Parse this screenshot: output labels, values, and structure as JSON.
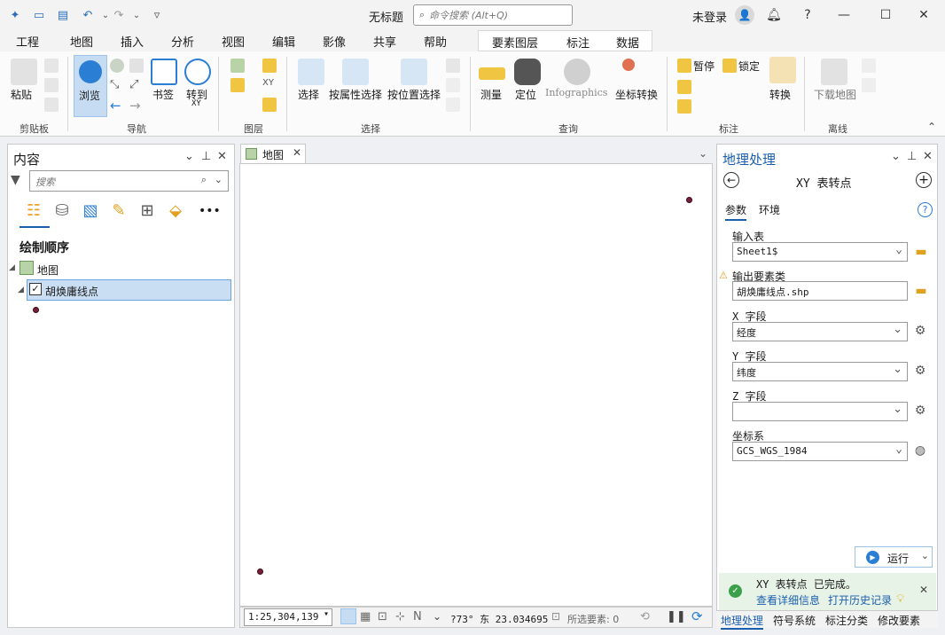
{
  "titlebar": {
    "doc_title": "无标题",
    "command_search_placeholder": "命令搜索 (Alt+Q)",
    "login": "未登录"
  },
  "ribbon_tabs": [
    "工程",
    "地图",
    "插入",
    "分析",
    "视图",
    "编辑",
    "影像",
    "共享",
    "帮助"
  ],
  "active_tab": "地图",
  "context_tabs": [
    "要素图层",
    "标注",
    "数据"
  ],
  "ribbon": {
    "paste": "粘贴",
    "browse": "浏览",
    "bookmark": "书签",
    "goto": "转到",
    "goto_sub": "XY",
    "select": "选择",
    "select_by_attr": "按属性选择",
    "select_by_loc": "按位置选择",
    "measure": "测量",
    "locate": "定位",
    "infographics": "Infographics",
    "coord_convert": "坐标转换",
    "pause": "暂停",
    "lock": "锁定",
    "convert": "转换",
    "download_map": "下载地图",
    "groups": {
      "clipboard": "剪贴板",
      "navigate": "导航",
      "layer": "图层",
      "selection": "选择",
      "inquiry": "查询",
      "labeling": "标注",
      "offline": "离线"
    }
  },
  "contents": {
    "title": "内容",
    "search_placeholder": "搜索",
    "draw_order": "绘制顺序",
    "map_node": "地图",
    "layer_name": "胡焕庸线点"
  },
  "map": {
    "tab_label": "地图",
    "scale": "1:25,304,139",
    "coords_text": "?73° 东 23.034695",
    "selected_features": "所选要素: 0"
  },
  "geoprocessing": {
    "title": "地理处理",
    "tool_title": "XY 表转点",
    "tabs": [
      "参数",
      "环境"
    ],
    "input_table_label": "输入表",
    "input_table_value": "Sheet1$",
    "output_label": "输出要素类",
    "output_value": "胡焕庸线点.shp",
    "x_label": "X 字段",
    "x_value": "经度",
    "y_label": "Y 字段",
    "y_value": "纬度",
    "z_label": "Z 字段",
    "z_value": "",
    "cs_label": "坐标系",
    "cs_value": "GCS_WGS_1984",
    "run": "运行",
    "done_msg": "XY 表转点 已完成。",
    "view_details": "查看详细信息",
    "open_history": "打开历史记录",
    "bottom_tabs": [
      "地理处理",
      "符号系统",
      "标注分类",
      "修改要素"
    ]
  },
  "colors": {
    "accent": "#1a5fae",
    "selected_row": "#c9def3",
    "point": "#7a1f3a",
    "success_bg": "#e8f3e8"
  }
}
